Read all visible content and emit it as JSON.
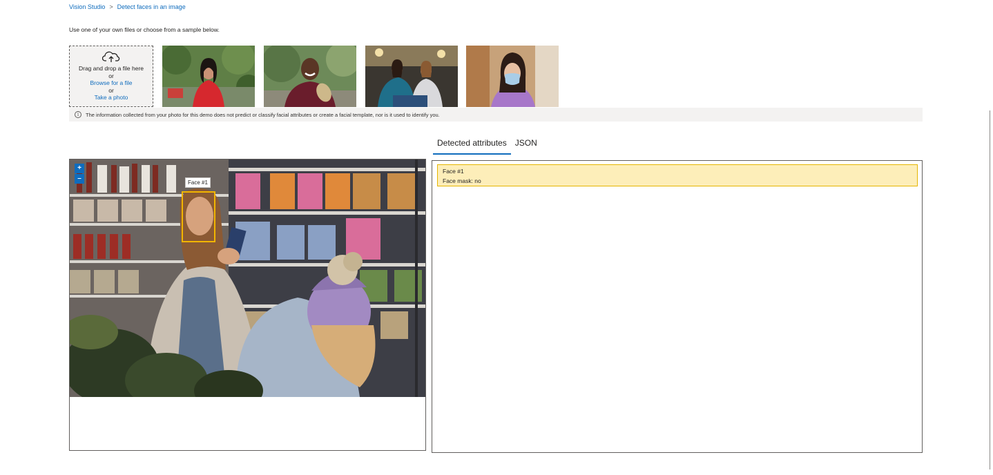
{
  "breadcrumb": {
    "root": "Vision Studio",
    "separator": ">",
    "current": "Detect faces in an image"
  },
  "instruction": "Use one of your own files or choose from a sample below.",
  "upload": {
    "icon": "cloud-upload-icon",
    "drag_text": "Drag and drop a file here",
    "or1": "or",
    "browse_link": "Browse for a file",
    "or2": "or",
    "photo_link": "Take a photo"
  },
  "samples": [
    {
      "name": "sample-woman-red-jacket"
    },
    {
      "name": "sample-man-holding-object"
    },
    {
      "name": "sample-two-women-seated"
    },
    {
      "name": "sample-woman-face-mask"
    }
  ],
  "notice": {
    "icon": "info-icon",
    "text": "The information collected from your photo for this demo does not predict or classify facial attributes or create a facial template, nor is it used to identify you."
  },
  "tabs": [
    {
      "label": "Detected attributes",
      "active": true
    },
    {
      "label": "JSON",
      "active": false
    }
  ],
  "image_panel": {
    "zoom_in": "+",
    "zoom_out": "–",
    "face_tag": "Face #1"
  },
  "results": {
    "face_title": "Face #1",
    "face_mask": "Face mask: no"
  },
  "colors": {
    "accent": "#0f6cbd",
    "face_box": "#f2b500",
    "result_bg": "#fdeeb9"
  }
}
